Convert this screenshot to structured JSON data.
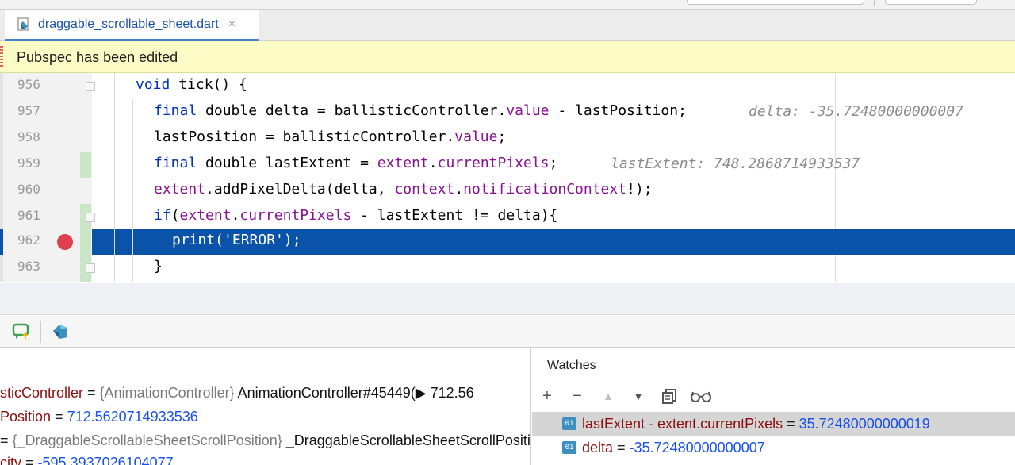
{
  "tab": {
    "filename": "draggable_scrollable_sheet.dart",
    "close_glyph": "×"
  },
  "banner": {
    "text": "Pubspec has been edited"
  },
  "editor": {
    "lines": [
      {
        "num": "956"
      },
      {
        "num": "957",
        "hint": "delta: -35.72480000000007"
      },
      {
        "num": "958"
      },
      {
        "num": "959",
        "hint": "lastExtent: 748.2868714933537"
      },
      {
        "num": "960"
      },
      {
        "num": "961"
      },
      {
        "num": "962"
      },
      {
        "num": "963"
      }
    ],
    "tokens": {
      "void": "void",
      "tick": " tick() {",
      "final": "final",
      "double": " double delta = ballisticController.",
      "value": "value",
      "minus_last": " - lastPosition;",
      "lastpos": "lastPosition = ballisticController.",
      "value2": "value",
      "semi": ";",
      "final2": "final",
      "double2": " double lastExtent = ",
      "extent": "extent",
      "dot": ".",
      "currentPixels": "currentPixels",
      "semi2": ";",
      "extent2": "extent",
      "addpd": ".addPixelDelta(delta, ",
      "context": "context",
      "dot2": ".",
      "notif": "notificationContext",
      "bang": "!);",
      "if": "if",
      "paren": "(",
      "extent3": "extent",
      "dot3": ".",
      "currentPixels2": "currentPixels",
      "rest961": " - lastExtent != delta){",
      "print": "print(",
      "error": "'ERROR'",
      "end962": ");",
      "brace": "}"
    }
  },
  "variables": [
    {
      "name": "sticController",
      "eq": " = ",
      "type": "{AnimationController}",
      "value": " AnimationController#45449(▶ 712.56"
    },
    {
      "name": "Position",
      "eq": " = ",
      "number": "712.5620714933536"
    },
    {
      "name": "",
      "eq": "= ",
      "type": "{_DraggableScrollableSheetScrollPosition}",
      "value": " _DraggableScrollableSheetScrollPosition"
    },
    {
      "name": "city",
      "eq": " = ",
      "number": "-595.3937026104077"
    }
  ],
  "watches": {
    "title": "Watches",
    "badge": "01",
    "tools": [
      "+",
      "−",
      "▲",
      "▼",
      "copy-icon",
      "glasses-icon"
    ],
    "items": [
      {
        "expr": "lastExtent - extent.currentPixels",
        "eq": " = ",
        "value": "35.72480000000019"
      },
      {
        "expr": "delta",
        "eq": " = ",
        "value": "-35.72480000000007"
      }
    ]
  },
  "colors": {
    "accent": "#0a53a8",
    "breakpoint": "#e0404d",
    "banner": "#fdfbc6",
    "name": "#8c0d0d",
    "number": "#1750eb"
  }
}
